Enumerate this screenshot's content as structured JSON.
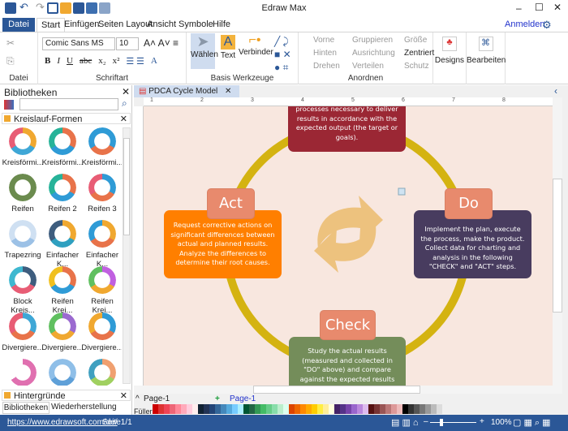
{
  "app": {
    "title": "Edraw Max"
  },
  "quick_access": [
    "app-icon",
    "undo-icon",
    "redo-icon",
    "new-icon",
    "open-icon",
    "save-icon",
    "print-icon",
    "export-icon"
  ],
  "tabs": [
    "Datei",
    "Start",
    "Einfügen",
    "Seiten Layout",
    "Ansicht",
    "Symbole",
    "Hilfe"
  ],
  "active_tab": "Start",
  "signin": "Anmelden",
  "ribbon": {
    "datei_label": "Datei",
    "font": "Comic Sans MS",
    "size": "10",
    "schriftart_label": "Schriftart",
    "format_buttons": [
      "B",
      "I",
      "U",
      "abc",
      "x₂",
      "x²"
    ],
    "tools": [
      "Wählen",
      "Text",
      "Verbinder"
    ],
    "basis_label": "Basis Werkzeuge",
    "arrange": [
      "Vorne",
      "Gruppieren",
      "Größe",
      "Hinten",
      "Ausrichtung",
      "Zentriert",
      "Drehen",
      "Verteilen",
      "Schutz"
    ],
    "anordnen_label": "Anordnen",
    "designs": "Designs",
    "bearbeiten": "Bearbeiten"
  },
  "library": {
    "title": "Bibliotheken",
    "search_placeholder": "",
    "section": "Kreislauf-Formen",
    "items": [
      "Kreisförmi...",
      "Kreisförmi...",
      "Kreisförmi...",
      "Reifen",
      "Reifen 2",
      "Reifen 3",
      "Trapezring",
      "Einfacher K...",
      "Einfacher K...",
      "Block Kreis...",
      "Reifen Krei...",
      "Reifen Krei...",
      "Divergiere...",
      "Divergiere...",
      "Divergiere...",
      "",
      "",
      ""
    ],
    "section2": "Hintergründe",
    "bottom_tabs": [
      "Bibliotheken",
      "Wiederherstellung"
    ]
  },
  "document": {
    "tab": "PDCA Cycle Model",
    "ruler": [
      "1",
      "2",
      "3",
      "4",
      "5",
      "6",
      "7",
      "8"
    ]
  },
  "diagram": {
    "plan_text": "processes necessary to deliver results in accordance with the expected output (the target or goals).",
    "act_title": "Act",
    "act_text": "Request corrective actions on significant differences between actual and planned results. Analyze the differences to determine their root causes.",
    "do_title": "Do",
    "do_text": "Implement the plan, execute the process, make the product. Collect data for charting and analysis in the following \"CHECK\" and \"ACT\" steps.",
    "check_title": "Check",
    "check_text": "Study the actual results (measured and collected in \"DO\" above) and compare against the expected results (targets or",
    "colors": {
      "plan": "#9b2734",
      "act": "#ff7f00",
      "do": "#483c5f",
      "check": "#748d5a",
      "tab": "#e88a6d",
      "ring": "#d4b311",
      "bg": "#f8e7df"
    }
  },
  "pages": {
    "current": "Page-1",
    "tab": "Page-1",
    "fill_label": "Füller"
  },
  "status": {
    "url": "https://www.edrawsoft.com/de/",
    "page": "Seite1/1",
    "zoom": "100%"
  }
}
